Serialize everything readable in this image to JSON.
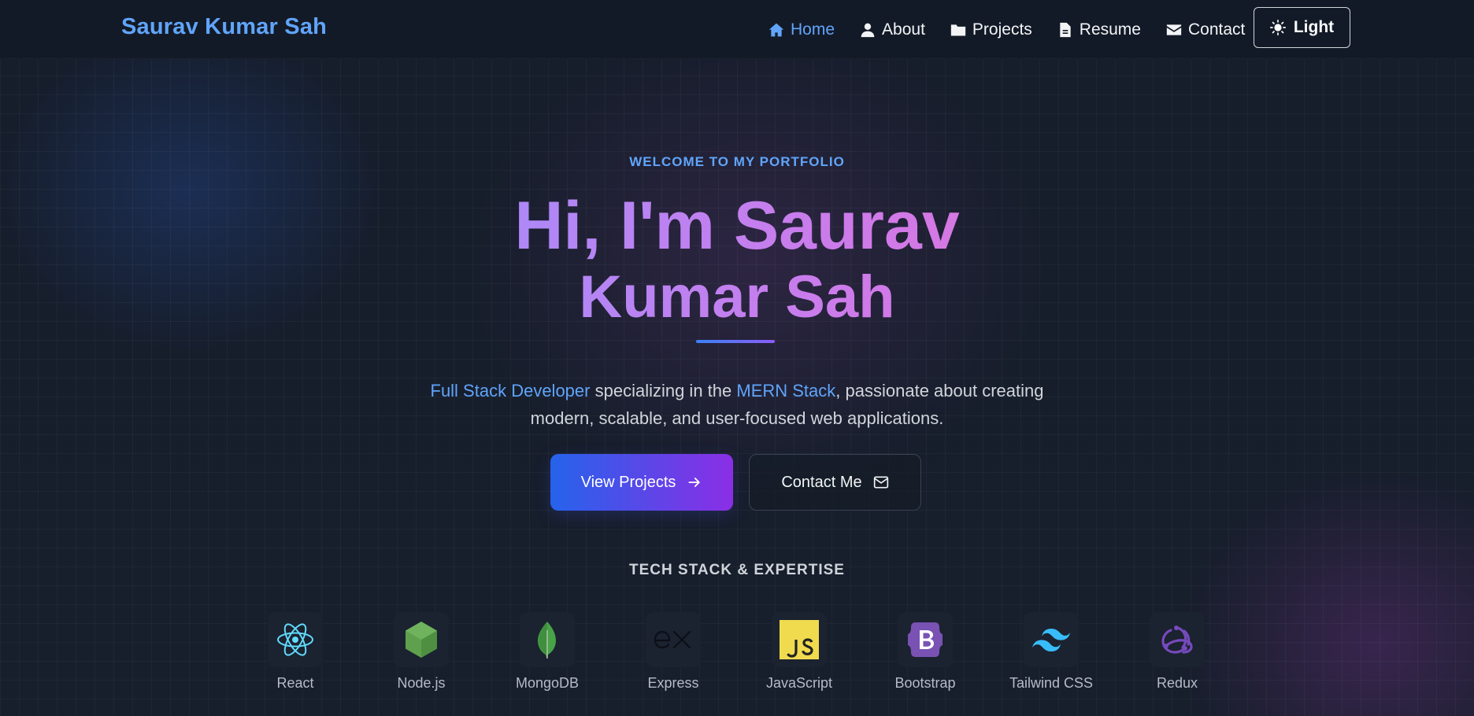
{
  "brand": "Saurav Kumar Sah",
  "nav": {
    "items": [
      {
        "label": "Home",
        "active": true,
        "icon": "home-icon"
      },
      {
        "label": "About",
        "active": false,
        "icon": "user-icon"
      },
      {
        "label": "Projects",
        "active": false,
        "icon": "folder-icon"
      },
      {
        "label": "Resume",
        "active": false,
        "icon": "file-icon"
      },
      {
        "label": "Contact",
        "active": false,
        "icon": "envelope-icon"
      }
    ],
    "theme_toggle": {
      "label": "Light",
      "icon": "sun-icon"
    }
  },
  "hero": {
    "eyebrow": "WELCOME TO MY PORTFOLIO",
    "title_line1": "Hi, I'm Saurav",
    "title_line2": "Kumar Sah",
    "tagline": {
      "hl1": "Full Stack Developer",
      "text1": " specializing in the ",
      "hl2": "MERN Stack",
      "text2": ", passionate about creating",
      "line2": "modern, scalable, and user-focused web applications."
    },
    "primary_button": "View Projects",
    "secondary_button": "Contact Me"
  },
  "tech_stack": {
    "title": "TECH STACK & EXPERTISE",
    "items": [
      {
        "label": "React",
        "icon": "react-icon"
      },
      {
        "label": "Node.js",
        "icon": "nodejs-icon"
      },
      {
        "label": "MongoDB",
        "icon": "mongodb-icon"
      },
      {
        "label": "Express",
        "icon": "express-icon"
      },
      {
        "label": "JavaScript",
        "icon": "javascript-icon"
      },
      {
        "label": "Bootstrap",
        "icon": "bootstrap-icon"
      },
      {
        "label": "Tailwind CSS",
        "icon": "tailwind-icon"
      },
      {
        "label": "Redux",
        "icon": "redux-icon"
      }
    ]
  },
  "colors": {
    "accent": "#60a5fa",
    "background": "#141b29",
    "gradient_start": "#2563eb",
    "gradient_end": "#8b2ee6"
  }
}
